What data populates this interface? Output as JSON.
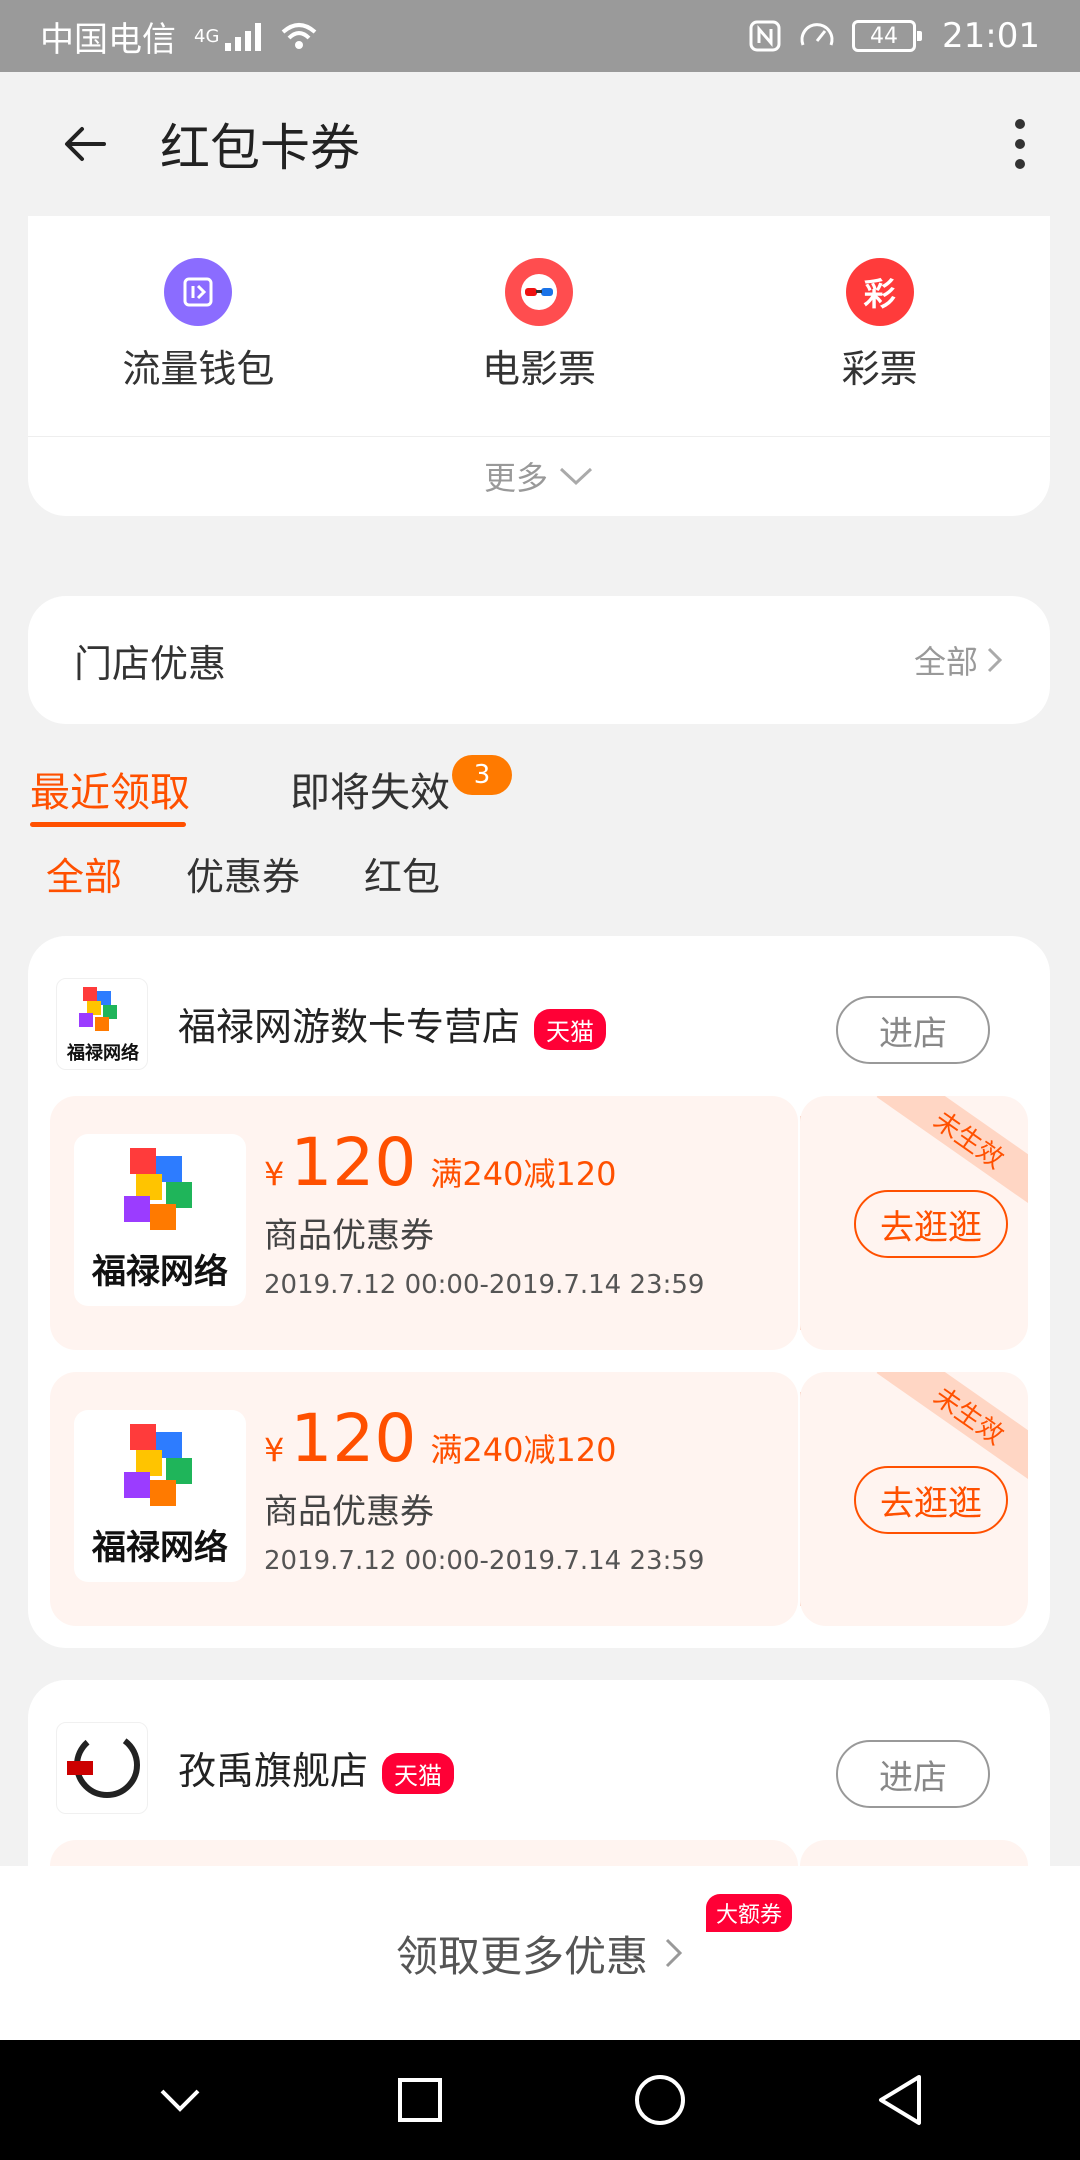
{
  "status": {
    "carrier": "中国电信",
    "network": "4G",
    "battery": "44",
    "time": "21:01"
  },
  "header": {
    "title": "红包卡券"
  },
  "quick": {
    "items": [
      {
        "label": "流量钱包",
        "icon": "traffic-wallet-icon",
        "color": "#8b6cff",
        "glyph": "1"
      },
      {
        "label": "电影票",
        "icon": "movie-ticket-icon",
        "color": "#ff4d4f",
        "glyph": ""
      },
      {
        "label": "彩票",
        "icon": "lottery-icon",
        "color": "#ff3b3b",
        "glyph": "彩"
      }
    ],
    "more": "更多"
  },
  "store_deals": {
    "title": "门店优惠",
    "all": "全部"
  },
  "tabs": {
    "recent": "最近领取",
    "expiring": "即将失效",
    "expiring_badge": "3"
  },
  "filters": {
    "all": "全部",
    "coupon": "优惠券",
    "red_packet": "红包"
  },
  "shop1": {
    "name": "福禄网游数卡专营店",
    "tag": "天猫",
    "logo_text": "福禄网络",
    "enter": "进店",
    "coupons": [
      {
        "currency": "¥",
        "amount": "120",
        "condition": "满240减120",
        "type": "商品优惠券",
        "validity": "2019.7.12 00:00-2019.7.14 23:59",
        "status": "未生效",
        "action": "去逛逛",
        "image_text": "福禄网络"
      },
      {
        "currency": "¥",
        "amount": "120",
        "condition": "满240减120",
        "type": "商品优惠券",
        "validity": "2019.7.12 00:00-2019.7.14 23:59",
        "status": "未生效",
        "action": "去逛逛",
        "image_text": "福禄网络"
      }
    ]
  },
  "shop2": {
    "name": "孜禹旗舰店",
    "tag": "天猫",
    "enter": "进店"
  },
  "promo": {
    "text": "领取更多优惠",
    "badge": "大额券"
  },
  "colors": {
    "accent": "#ff5000",
    "tmall": "#ff0036"
  }
}
